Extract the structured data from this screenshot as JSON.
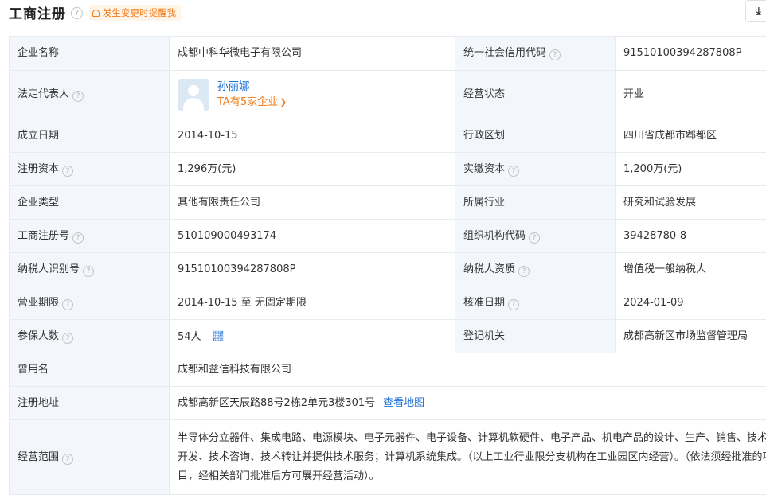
{
  "header": {
    "title": "工商注册",
    "notify_label": "发生变更时提醒我"
  },
  "fields": {
    "company_name": {
      "label": "企业名称",
      "value": "成都中科华微电子有限公司"
    },
    "credit_code": {
      "label": "统一社会信用代码",
      "value": "91510100394287808P"
    },
    "legal_rep": {
      "label": "法定代表人",
      "name": "孙丽娜",
      "link": "TA有5家企业"
    },
    "status": {
      "label": "经营状态",
      "value": "开业"
    },
    "founded": {
      "label": "成立日期",
      "value": "2014-10-15"
    },
    "region": {
      "label": "行政区划",
      "value": "四川省成都市郫都区"
    },
    "reg_capital": {
      "label": "注册资本",
      "value": "1,296万(元)"
    },
    "paid_capital": {
      "label": "实缴资本",
      "value": "1,200万(元)"
    },
    "company_type": {
      "label": "企业类型",
      "value": "其他有限责任公司"
    },
    "industry": {
      "label": "所属行业",
      "value": "研究和试验发展"
    },
    "reg_number": {
      "label": "工商注册号",
      "value": "510109000493174"
    },
    "org_code": {
      "label": "组织机构代码",
      "value": "39428780-8"
    },
    "taxpayer_id": {
      "label": "纳税人识别号",
      "value": "91510100394287808P"
    },
    "taxpayer_qual": {
      "label": "纳税人资质",
      "value": "增值税一般纳税人"
    },
    "business_term": {
      "label": "营业期限",
      "value": "2014-10-15 至 无固定期限"
    },
    "approval_date": {
      "label": "核准日期",
      "value": "2024-01-09"
    },
    "insured": {
      "label": "参保人数",
      "value": "54人"
    },
    "registrar": {
      "label": "登记机关",
      "value": "成都高新区市场监督管理局"
    },
    "former_name": {
      "label": "曾用名",
      "value": "成都和益信科技有限公司"
    },
    "address": {
      "label": "注册地址",
      "value": "成都高新区天辰路88号2栋2单元3楼301号",
      "map_link": "查看地图"
    },
    "scope": {
      "label": "经营范围",
      "value": "半导体分立器件、集成电路、电源模块、电子元器件、电子设备、计算机软硬件、电子产品、机电产品的设计、生产、销售、技术开发、技术咨询、技术转让并提供技术服务；计算机系统集成。（以上工业行业限分支机构在工业园区内经营）。（依法须经批准的项目，经相关部门批准后方可展开经营活动）。"
    }
  }
}
